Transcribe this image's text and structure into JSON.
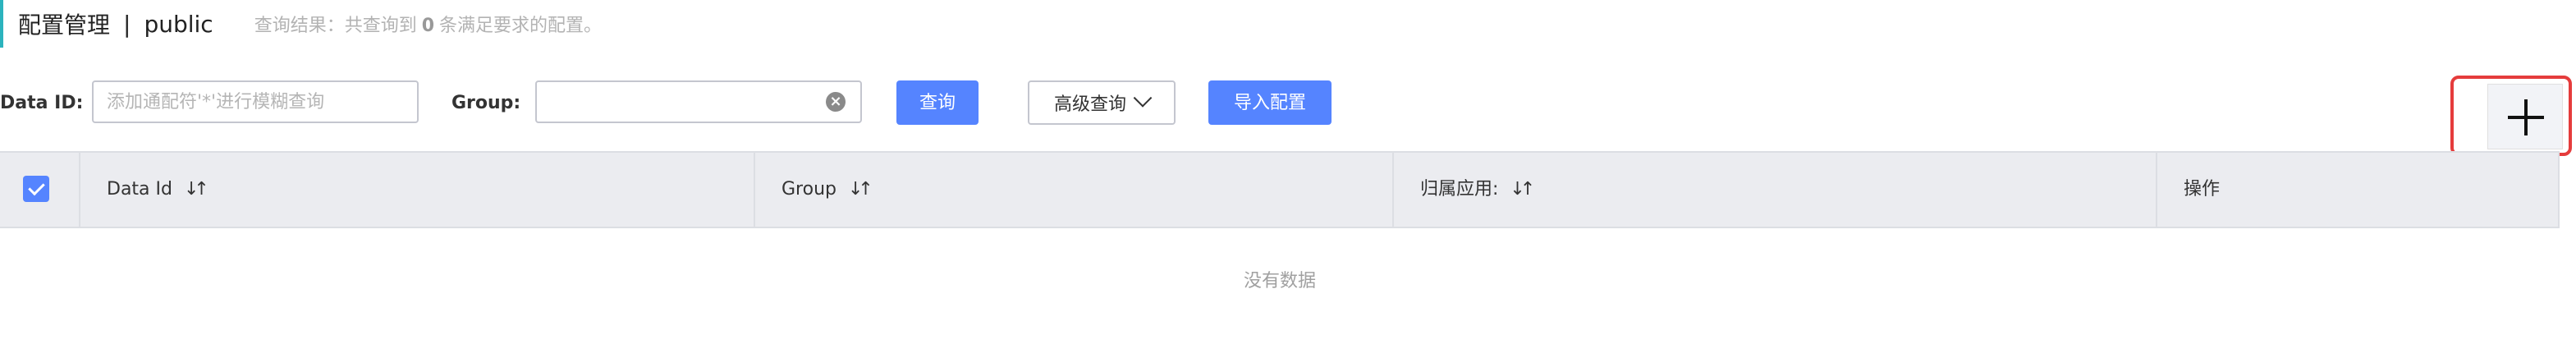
{
  "header": {
    "title": "配置管理",
    "separator": "|",
    "namespace": "public",
    "result_prefix": "查询结果：共查询到",
    "result_count": "0",
    "result_suffix": "条满足要求的配置。"
  },
  "filters": {
    "data_id_label": "Data ID:",
    "data_id_placeholder": "添加通配符'*'进行模糊查询",
    "data_id_value": "",
    "group_label": "Group:",
    "group_value": "",
    "query_button": "查询",
    "advanced_query_button": "高级查询",
    "import_button": "导入配置"
  },
  "add_button": {
    "icon": "plus-icon"
  },
  "table": {
    "select_all_checked": true,
    "columns": [
      {
        "label": "Data Id",
        "sortable": true
      },
      {
        "label": "Group",
        "sortable": true
      },
      {
        "label": "归属应用:",
        "sortable": true
      },
      {
        "label": "操作",
        "sortable": false
      }
    ],
    "rows": [],
    "empty_text": "没有数据"
  },
  "colors": {
    "accent": "#5584ff",
    "highlight_border": "#e53c3c",
    "header_accent": "#2bb3bd"
  }
}
